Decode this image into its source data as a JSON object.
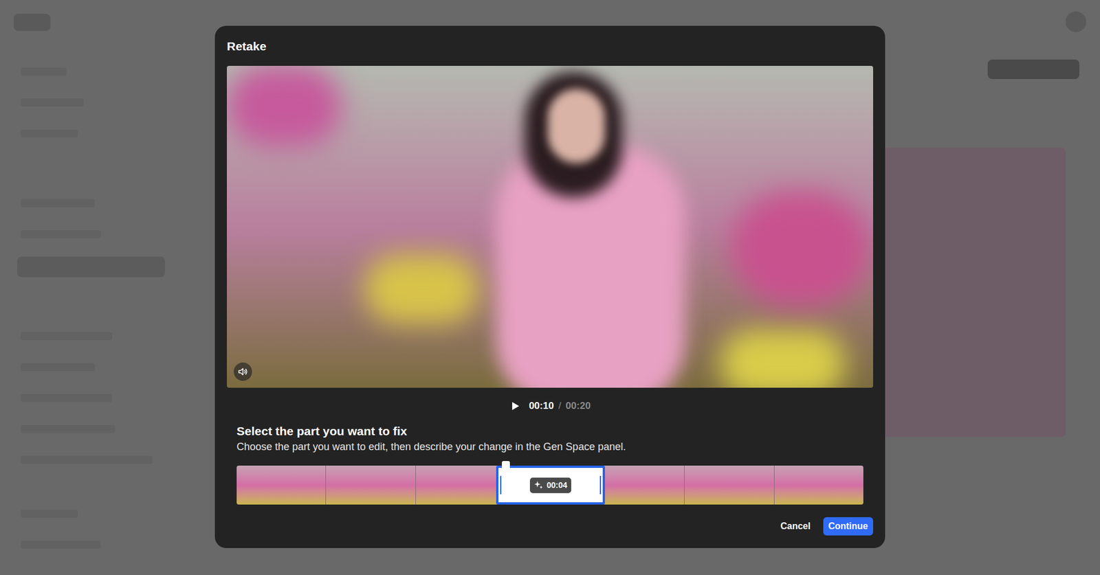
{
  "dialog": {
    "title": "Retake"
  },
  "player": {
    "muted": false,
    "current_time": "00:10",
    "separator": "/",
    "duration": "00:20"
  },
  "timeline": {
    "heading": "Select the part you want to fix",
    "description": "Choose the part you want to edit, then describe your change in the Gen Space panel.",
    "playhead": 0.43,
    "selection": {
      "start": 0.414,
      "end": 0.588,
      "length": "00:04"
    }
  },
  "buttons": [
    {
      "label": "Cancel",
      "primary": false
    },
    {
      "label": "Continue",
      "primary": true
    }
  ]
}
